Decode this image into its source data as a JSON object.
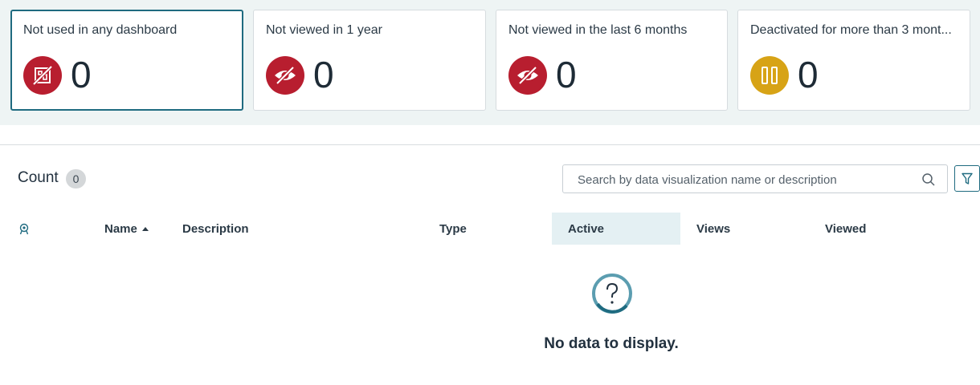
{
  "cards": [
    {
      "title": "Not used in any dashboard",
      "value": "0",
      "icon": "unused-dashboard-icon",
      "icon_color": "#b81e2f",
      "selected": true
    },
    {
      "title": "Not viewed in 1 year",
      "value": "0",
      "icon": "eye-slash-icon",
      "icon_color": "#b81e2f"
    },
    {
      "title": "Not viewed in the last 6 months",
      "value": "0",
      "icon": "eye-slash-icon",
      "icon_color": "#b81e2f"
    },
    {
      "title": "Deactivated for more than 3 mont...",
      "value": "0",
      "icon": "pause-icon",
      "icon_color": "#d7a316"
    }
  ],
  "list": {
    "count_label": "Count",
    "count_value": "0",
    "search_placeholder": "Search by data visualization name or description",
    "columns": {
      "name": "Name",
      "description": "Description",
      "type": "Type",
      "active": "Active",
      "views": "Views",
      "viewed": "Viewed"
    },
    "sort": {
      "column": "Name",
      "direction": "ascending"
    },
    "empty_message": "No data to display."
  },
  "colors": {
    "accent": "#1f6b80",
    "danger": "#b81e2f",
    "warning": "#d7a316",
    "active_column": "#e4f0f3"
  }
}
